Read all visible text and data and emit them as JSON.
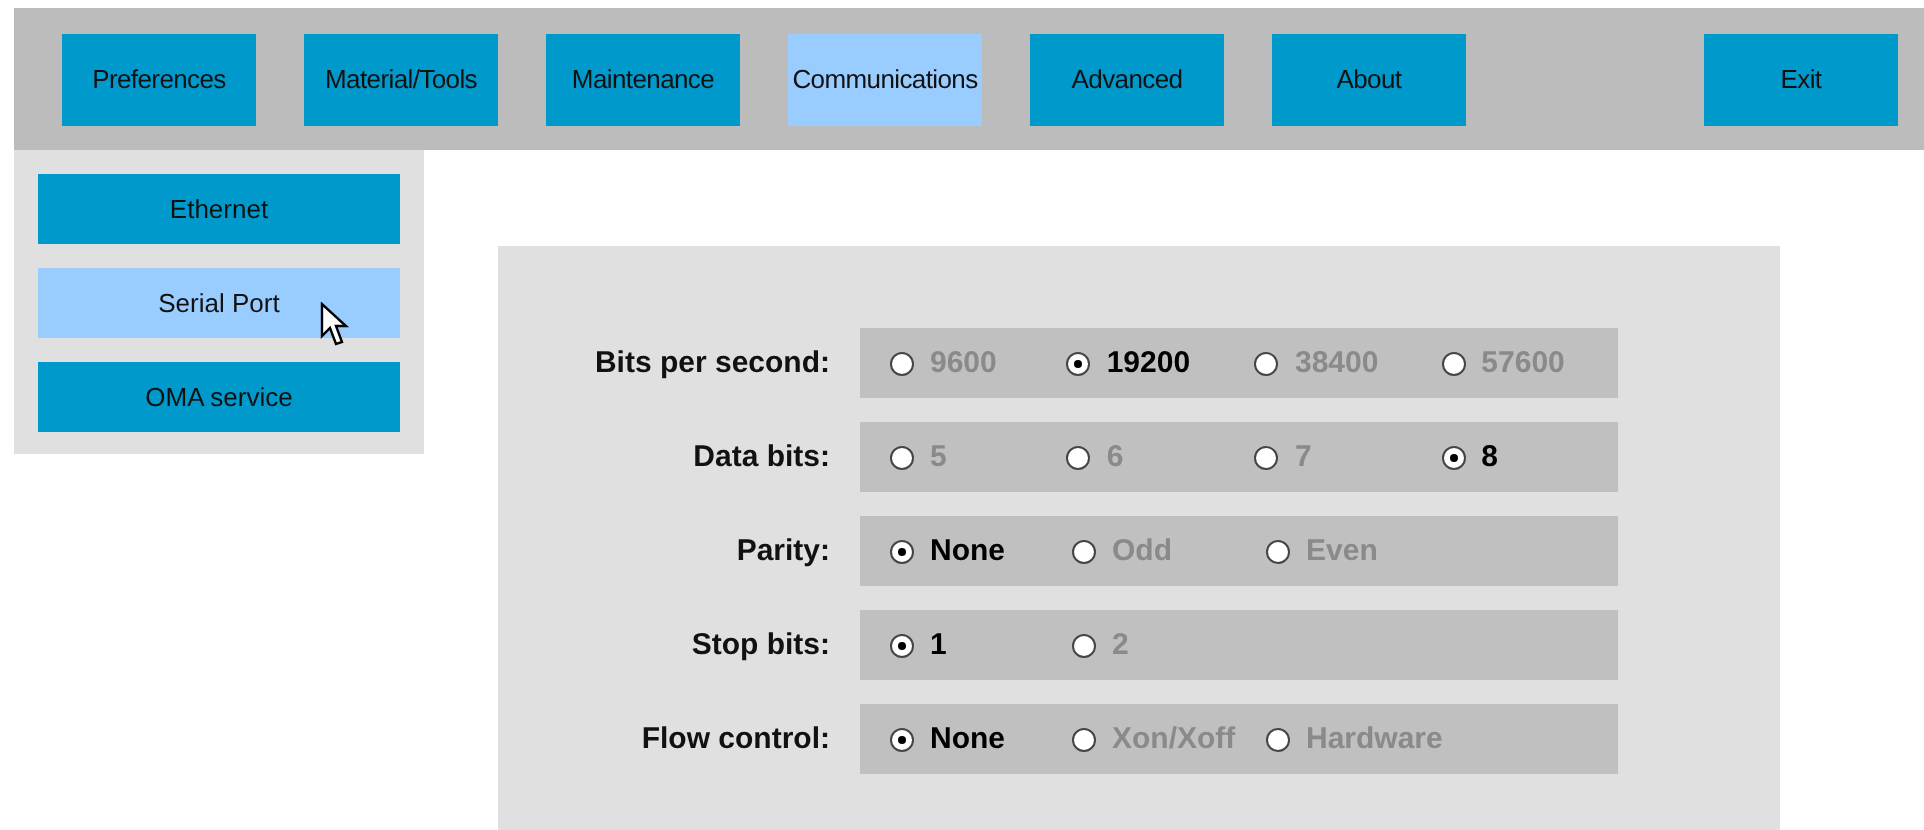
{
  "menu": [
    {
      "label": "Preferences",
      "selected": false
    },
    {
      "label": "Material/Tools",
      "selected": false
    },
    {
      "label": "Maintenance",
      "selected": false
    },
    {
      "label": "Communications",
      "selected": true
    },
    {
      "label": "Advanced",
      "selected": false
    },
    {
      "label": "About",
      "selected": false
    }
  ],
  "exit_button": "Exit",
  "sidebar": {
    "items": [
      {
        "label": "Ethernet",
        "selected": false
      },
      {
        "label": "Serial Port",
        "selected": true,
        "hovered": true
      },
      {
        "label": "OMA service",
        "selected": false
      }
    ]
  },
  "settings": [
    {
      "label": "Bits per second:",
      "options": [
        {
          "label": "9600",
          "selected": false
        },
        {
          "label": "19200",
          "selected": true
        },
        {
          "label": "38400",
          "selected": false
        },
        {
          "label": "57600",
          "selected": false
        }
      ]
    },
    {
      "label": "Data bits:",
      "options": [
        {
          "label": "5",
          "selected": false
        },
        {
          "label": "6",
          "selected": false
        },
        {
          "label": "7",
          "selected": false
        },
        {
          "label": "8",
          "selected": true
        }
      ]
    },
    {
      "label": "Parity:",
      "options": [
        {
          "label": "None",
          "selected": true
        },
        {
          "label": "Odd",
          "selected": false
        },
        {
          "label": "Even",
          "selected": false
        }
      ]
    },
    {
      "label": "Stop bits:",
      "options": [
        {
          "label": "1",
          "selected": true
        },
        {
          "label": "2",
          "selected": false
        }
      ]
    },
    {
      "label": "Flow control:",
      "options": [
        {
          "label": "None",
          "selected": true
        },
        {
          "label": "Xon/Xoff",
          "selected": false
        },
        {
          "label": "Hardware",
          "selected": false
        }
      ]
    }
  ]
}
